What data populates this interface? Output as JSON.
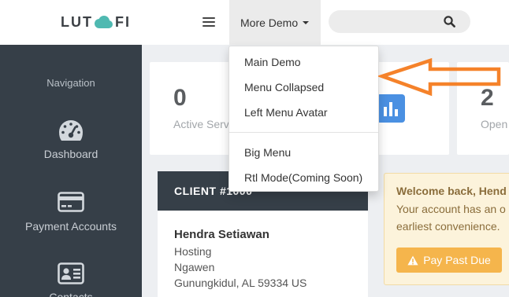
{
  "colors": {
    "sidebar_bg": "#363f48",
    "main_bg": "#edeff2",
    "logo_cloud": "#4fb9b1",
    "stat_icon_bg": "#4a90e2",
    "alert_bg": "#fcf3db",
    "alert_border": "#f2dba5",
    "alert_text": "#8a6d3b",
    "button_bg": "#f5b54c",
    "annotation_arrow": "#f5822a"
  },
  "header": {
    "logo": {
      "text_left": "LUT",
      "icon": "cloud-logo-icon",
      "text_right": "FI"
    },
    "menu_toggle_icon": "hamburger-menu-icon",
    "more_demo": {
      "label": "More Demo",
      "icon": "caret-down-icon"
    },
    "search": {
      "value": "",
      "icon": "search-icon"
    }
  },
  "dropdown": {
    "groups": [
      {
        "items": [
          {
            "label": "Main Demo"
          },
          {
            "label": "Menu Collapsed"
          },
          {
            "label": "Left Menu Avatar"
          }
        ]
      },
      {
        "items": [
          {
            "label": "Big Menu"
          },
          {
            "label": "Rtl Mode(Coming Soon)"
          }
        ]
      }
    ]
  },
  "sidebar": {
    "heading": "Navigation",
    "items": [
      {
        "label": "Dashboard",
        "icon": "tachometer-icon"
      },
      {
        "label": "Payment Accounts",
        "icon": "credit-card-icon"
      },
      {
        "label": "Contacts",
        "icon": "id-card-icon"
      }
    ]
  },
  "stats": [
    {
      "value": "0",
      "label": "Active Serv",
      "icon": "bar-chart-icon"
    },
    {
      "value": "2",
      "label": "Open"
    }
  ],
  "client": {
    "header": "CLIENT #1000",
    "name": "Hendra Setiawan",
    "lines": [
      "Hosting",
      "Ngawen",
      "Gunungkidul, AL 59334 US"
    ]
  },
  "alert": {
    "title": "Welcome back, Hend",
    "lines": [
      "Your account has an o",
      "earliest convenience."
    ],
    "button": {
      "label": "Pay Past Due",
      "icon": "warning-icon"
    }
  }
}
